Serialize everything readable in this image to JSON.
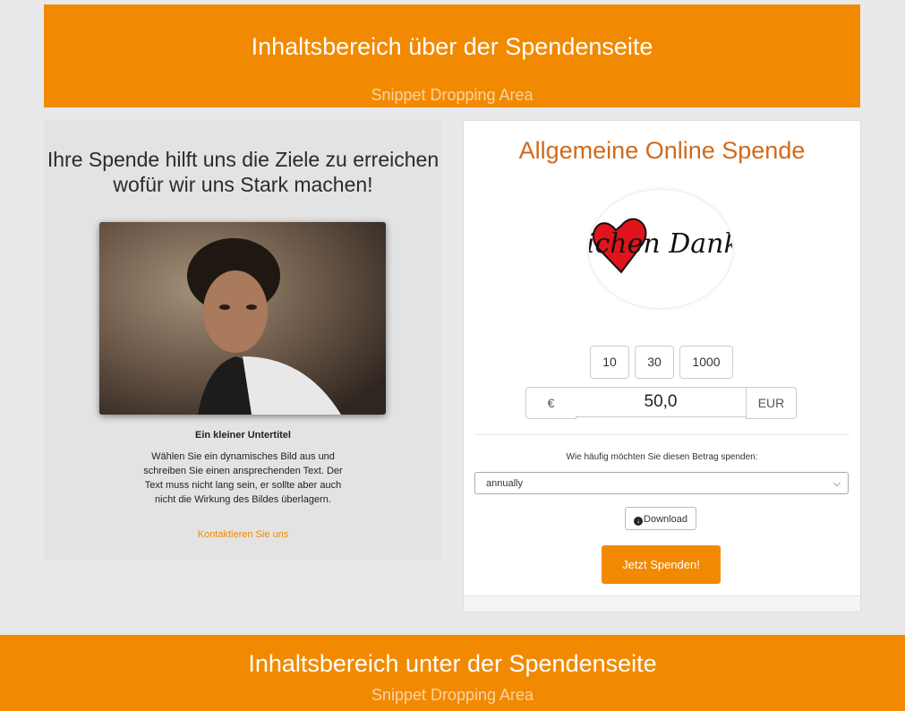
{
  "top_banner": {
    "title": "Inhaltsbereich über der Spendenseite",
    "subtitle": "Snippet Dropping Area"
  },
  "left_panel": {
    "heading": "Ihre Spende hilft uns die Ziele zu erreichen wofür wir uns Stark machen!",
    "subtitle": "Ein kleiner Untertitel",
    "text": "Wählen Sie ein dynamisches Bild aus und schreiben Sie einen ansprechenden Text. Der Text muss nicht lang sein, er sollte aber auch nicht die Wirkung des Bildes überlagern.",
    "link": "Kontaktieren Sie uns"
  },
  "donation_form": {
    "title": "Allgemeine Online Spende",
    "logo_text": "lichen Dank",
    "amounts": [
      "10",
      "30",
      "1000"
    ],
    "currency_symbol": "€",
    "amount_value": "50,0",
    "currency_code": "EUR",
    "frequency_label": "Wie häufig möchten Sie diesen Betrag spenden:",
    "frequency_selected": "annually",
    "download_label": "Download",
    "submit_label": "Jetzt Spenden!"
  },
  "bottom_banner": {
    "title": "Inhaltsbereich unter der Spendenseite",
    "subtitle": "Snippet Dropping Area"
  },
  "colors": {
    "accent": "#f18a00",
    "title_orange": "#d06a1c",
    "background": "#e9e9eb"
  }
}
